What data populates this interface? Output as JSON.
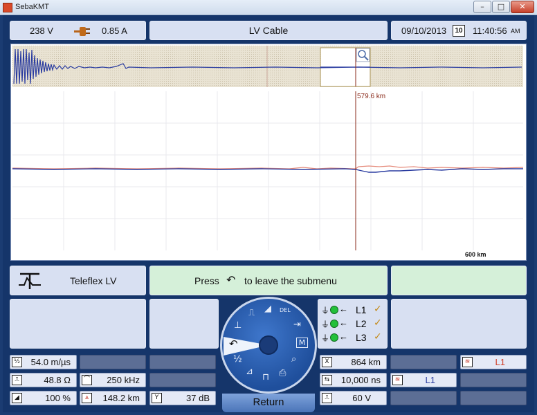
{
  "window": {
    "title": "SebaKMT"
  },
  "header": {
    "voltage": "238 V",
    "current": "0.85 A",
    "title": "LV Cable",
    "date": "09/10/2013",
    "calendar_day": "10",
    "time": "11:40:56",
    "time_suffix": "AM"
  },
  "graph": {
    "cursor_label": "579.6 km",
    "range_label": "600 km"
  },
  "mode": {
    "name": "Teleflex LV",
    "hint_prefix": "Press",
    "hint_suffix": "to leave the submenu"
  },
  "wheel": {
    "return_label": "Return"
  },
  "lines": [
    {
      "label": "L1",
      "checked": true
    },
    {
      "label": "L2",
      "checked": true
    },
    {
      "label": "L3",
      "checked": true
    }
  ],
  "params": {
    "velocity": "54.0 m/µs",
    "impedance": "48.8 Ω",
    "frequency": "250 kHz",
    "gain": "100 %",
    "distance": "148.2 km",
    "amplification": "37 dB",
    "cursor_x": "864 km",
    "pulse_width": "10,000 ns",
    "pulse_voltage": "60 V",
    "channel_top": "L1",
    "channel_mid": "L1"
  },
  "colors": {
    "trace_blue": "#2a3ca0",
    "trace_red": "#e58a7a",
    "cursor": "#8a2a1a",
    "accent_green": "#22c03a"
  }
}
